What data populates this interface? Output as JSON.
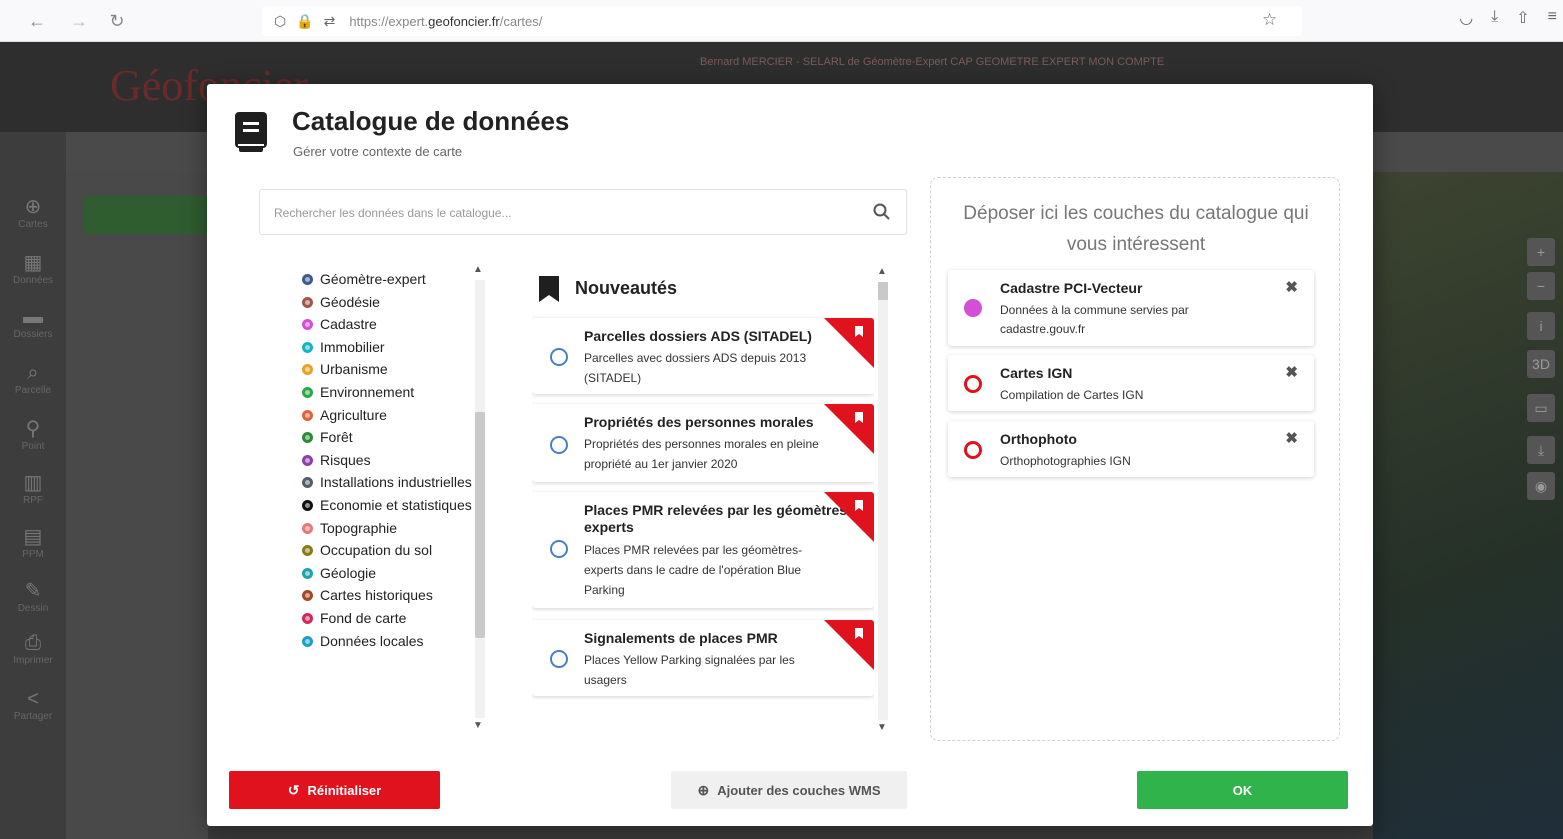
{
  "browser": {
    "url_prefix": "https://expert.",
    "url_domain": "geofoncier.fr",
    "url_path": "/cartes/"
  },
  "app": {
    "logo": "Géofoncier",
    "header_user": "Bernard MERCIER - SELARL de Géomètre-Expert CAP GEOMETRE EXPERT    MON COMPTE"
  },
  "rail": [
    "Cartes",
    "Données",
    "Dossiers",
    "Parcelle",
    "Point",
    "RPF",
    "PPM",
    "Dessin",
    "Imprimer",
    "Partager"
  ],
  "modal": {
    "title": "Catalogue de données",
    "subtitle": "Gérer votre contexte de carte",
    "search_placeholder": "Rechercher les données dans le catalogue...",
    "categories": [
      {
        "label": "Géomètre-expert",
        "color": "#3d5a8a"
      },
      {
        "label": "Géodésie",
        "color": "#a0564a"
      },
      {
        "label": "Cadastre",
        "color": "#d24fd6"
      },
      {
        "label": "Immobilier",
        "color": "#17b3c2"
      },
      {
        "label": "Urbanisme",
        "color": "#e7a326"
      },
      {
        "label": "Environnement",
        "color": "#2ea84a"
      },
      {
        "label": "Agriculture",
        "color": "#e0633a"
      },
      {
        "label": "Forêt",
        "color": "#2d8a3a"
      },
      {
        "label": "Risques",
        "color": "#8e3ea8"
      },
      {
        "label": "Installations industrielles",
        "color": "#555f6a"
      },
      {
        "label": "Economie et statistiques",
        "color": "#111111"
      },
      {
        "label": "Topographie",
        "color": "#e6777a"
      },
      {
        "label": "Occupation du sol",
        "color": "#8a7a1a"
      },
      {
        "label": "Géologie",
        "color": "#20a2a8"
      },
      {
        "label": "Cartes historiques",
        "color": "#a04a2a"
      },
      {
        "label": "Fond de carte",
        "color": "#d2285a"
      },
      {
        "label": "Données locales",
        "color": "#1aa0c8"
      }
    ],
    "nouveautes_title": "Nouveautés",
    "nouveautes": [
      {
        "title": "Parcelles dossiers ADS (SITADEL)",
        "desc": "Parcelles avec dossiers ADS depuis 2013 (SITADEL)"
      },
      {
        "title": "Propriétés des personnes morales",
        "desc": "Propriétés des personnes morales en pleine propriété au 1er janvier 2020"
      },
      {
        "title": "Places PMR relevées par les géomètres-experts",
        "desc": "Places PMR relevées par les géomètres-experts dans le cadre de l'opération Blue Parking"
      },
      {
        "title": "Signalements de places PMR",
        "desc": "Places Yellow Parking signalées par les usagers"
      }
    ],
    "drop_text": "Déposer ici les couches du catalogue qui vous intéressent",
    "layers": [
      {
        "title": "Cadastre PCI-Vecteur",
        "desc": "Données à la commune servies par cadastre.gouv.fr",
        "color": "#d24fd6"
      },
      {
        "title": "Cartes IGN",
        "desc": "Compilation de Cartes IGN",
        "color": "#e0121d"
      },
      {
        "title": "Orthophoto",
        "desc": "Orthophotographies IGN",
        "color": "#e0121d"
      }
    ],
    "buttons": {
      "reset": "Réinitialiser",
      "wms": "Ajouter des couches WMS",
      "ok": "OK"
    }
  },
  "colors": {
    "accent_red": "#e0121d",
    "ok_green": "#2fb34a"
  }
}
